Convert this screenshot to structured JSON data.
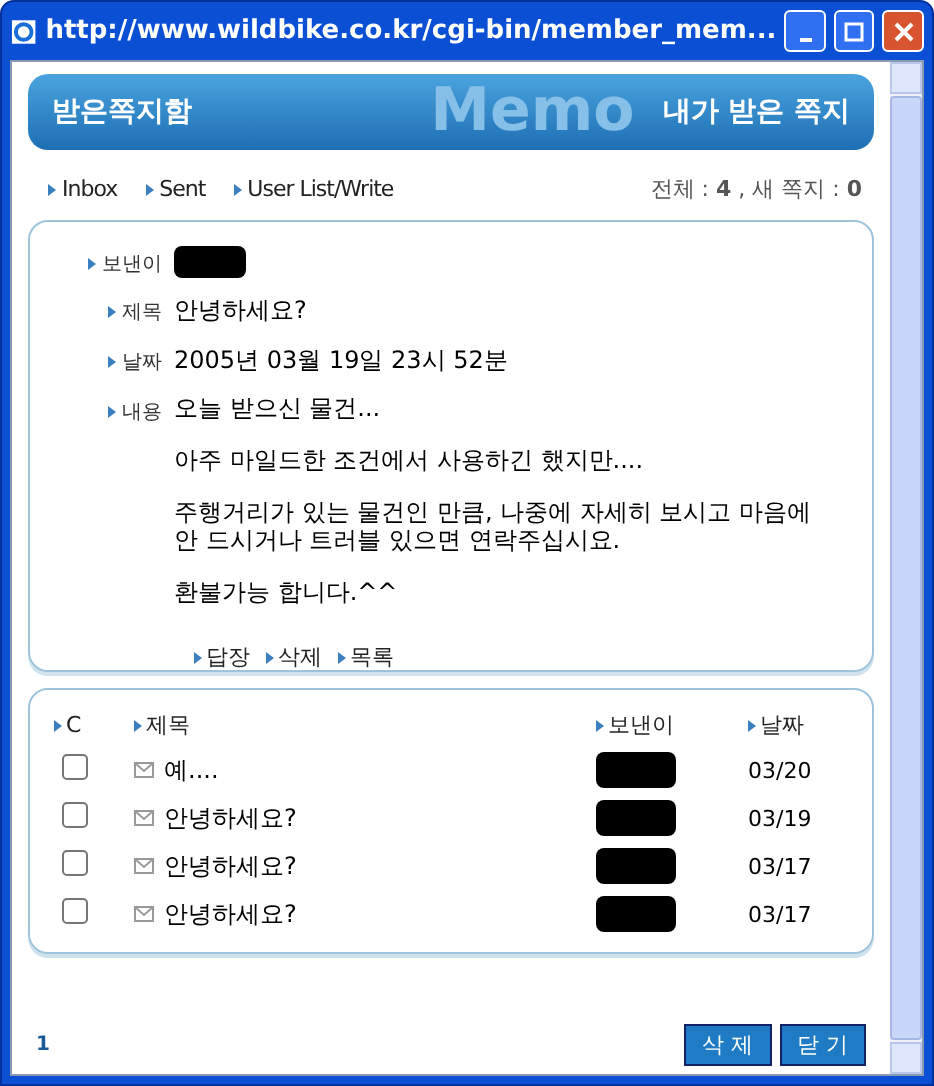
{
  "window": {
    "title": "http://www.wildbike.co.kr/cgi-bin/member_mem..."
  },
  "banner": {
    "title": "받은쪽지함",
    "subtitle": "내가 받은 쪽지",
    "background_text": "Memo"
  },
  "nav": [
    "Inbox",
    "Sent",
    "User List/Write"
  ],
  "stats": "전체 : **4** , 새 쪽지 : **0**",
  "message": {
    "fields": [
      {
        "label": "보낸이",
        "kind": "redacted"
      },
      {
        "label": "제목",
        "kind": "text",
        "value": "안녕하세요?"
      },
      {
        "label": "날짜",
        "kind": "text",
        "value": "2005년 03월 19일 23시 52분"
      },
      {
        "label": "내용",
        "kind": "body",
        "paragraphs": [
          "오늘 받으신 물건...",
          "아주 마일드한 조건에서 사용하긴 했지만....",
          "주행거리가 있는 물건인 만큼, 나중에 자세히 보시고 마음에 안 드시거나 트러블 있으면 연락주십시요.",
          "환불가능 합니다.^^"
        ]
      }
    ],
    "actions": [
      "답장",
      "삭제",
      "목록"
    ]
  },
  "list": {
    "columns": [
      "C",
      "제목",
      "보낸이",
      "날짜"
    ],
    "rows": [
      {
        "checked": false,
        "subject": "예....",
        "date": "03/20"
      },
      {
        "checked": false,
        "subject": "안녕하세요?",
        "date": "03/19"
      },
      {
        "checked": false,
        "subject": "안녕하세요?",
        "date": "03/17"
      },
      {
        "checked": false,
        "subject": "안녕하세요?",
        "date": "03/17"
      }
    ]
  },
  "pages": [
    "1"
  ],
  "buttons": [
    "삭 제",
    "닫 기"
  ]
}
